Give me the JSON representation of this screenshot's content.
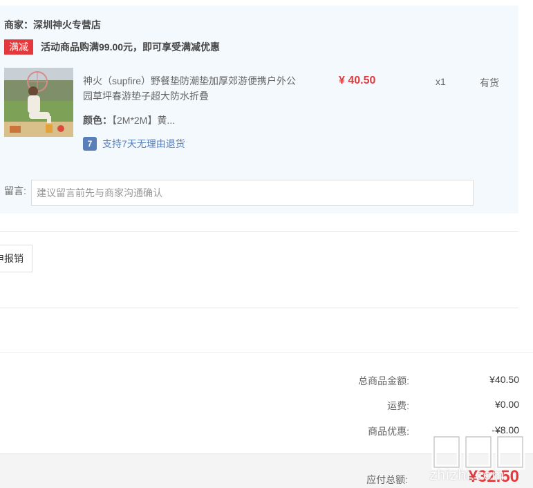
{
  "shop": {
    "name": "商家：深圳神火专营店",
    "promo_tag": "满减",
    "promo_text": "活动商品购满99.00元，即可享受满减优惠"
  },
  "product": {
    "image_icon": "product-photo-picnic-mat",
    "title": "神火（supfire）野餐垫防潮垫加厚郊游便携户外公园草坪春游垫子超大防水折叠",
    "price": "¥ 40.50",
    "quantity": "x1",
    "stock": "有货",
    "spec_label": "颜色：",
    "spec_value": "【2M*2M】黄...",
    "return_icon_glyph": "7",
    "return_policy": "支持7天无理由退货"
  },
  "remark": {
    "label": "留言:",
    "placeholder": "建议留言前先与商家沟通确认"
  },
  "invoice": {
    "button_label": "申报销"
  },
  "summary": {
    "goods_total_label": "总商品金额:",
    "goods_total_value": "¥40.50",
    "shipping_label": "运费:",
    "shipping_value": "¥0.00",
    "discount_label": "商品优惠:",
    "discount_value": "-¥8.00",
    "payable_label": "应付总额:",
    "payable_value": "¥32.50"
  },
  "watermark": {
    "glyphs": "值值值",
    "text": "zhizhi.com"
  },
  "colors": {
    "accent_red": "#e4393c",
    "panel_bg": "#f3f9fd",
    "link_blue": "#5a7fb8"
  }
}
